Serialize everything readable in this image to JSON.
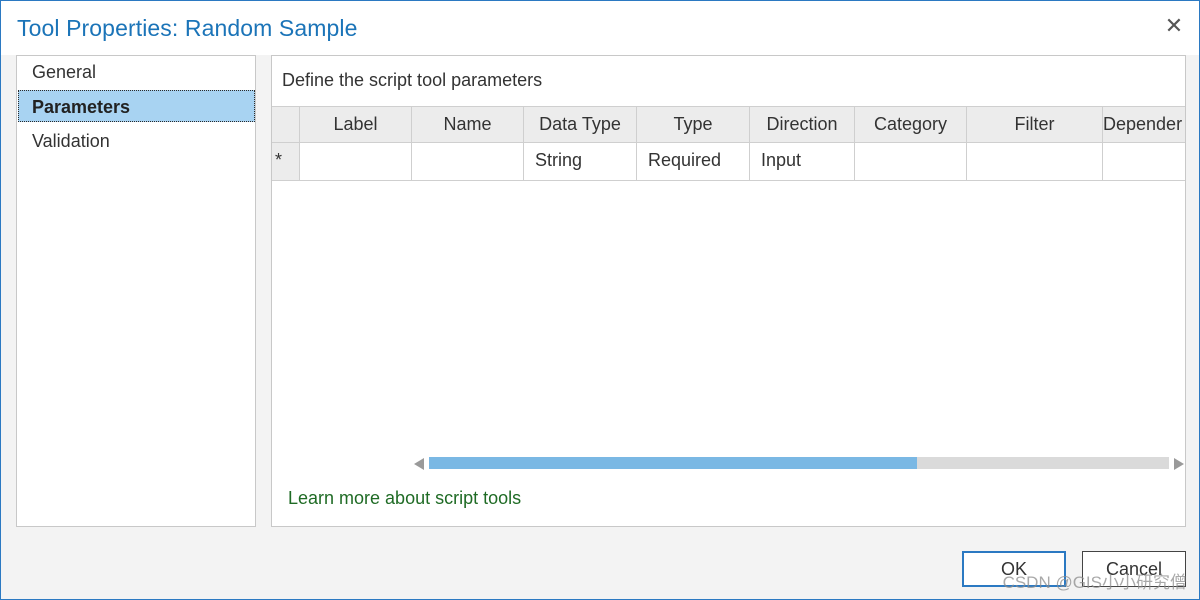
{
  "window": {
    "title": "Tool Properties: Random Sample",
    "close_symbol": "✕"
  },
  "nav": {
    "items": [
      {
        "label": "General",
        "selected": false
      },
      {
        "label": "Parameters",
        "selected": true
      },
      {
        "label": "Validation",
        "selected": false
      }
    ]
  },
  "main": {
    "instructions": "Define the script tool parameters",
    "columns": [
      "Label",
      "Name",
      "Data Type",
      "Type",
      "Direction",
      "Category",
      "Filter",
      "Depender"
    ],
    "new_row": {
      "marker": "*",
      "cells": [
        "",
        "",
        "String",
        "Required",
        "Input",
        "",
        "",
        ""
      ]
    },
    "scrollbar": {
      "position_fraction": 0.66
    },
    "learn_more": "Learn more about script tools"
  },
  "footer": {
    "ok_label": "OK",
    "cancel_label": "Cancel"
  },
  "watermark": "CSDN @GIS小小研究僧",
  "colors": {
    "title": "#1b74b8",
    "selection": "#a8d3f2",
    "link": "#1f6b25",
    "scroll_thumb": "#7ab8e4"
  }
}
